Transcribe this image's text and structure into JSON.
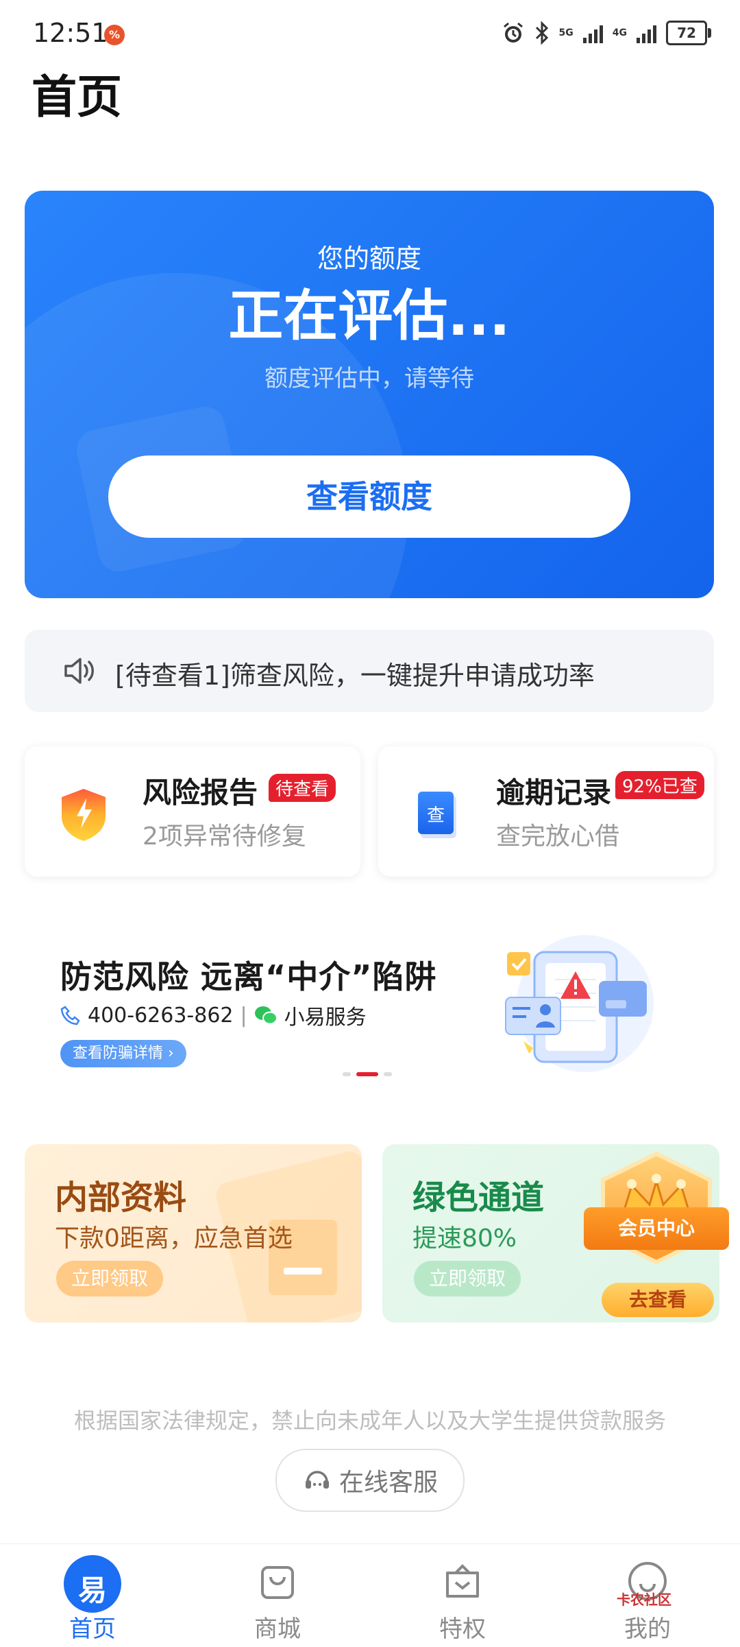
{
  "status_bar": {
    "time": "12:51",
    "notif_badge": "%",
    "signal_1": "5G",
    "signal_2": "4G",
    "battery": "72"
  },
  "page": {
    "title": "首页"
  },
  "hero": {
    "subtitle": "您的额度",
    "title": "正在评估...",
    "note": "额度评估中，请等待",
    "button": "查看额度",
    "color_start": "#2a84fb",
    "color_end": "#1463ec"
  },
  "notice": {
    "text": "[待查看1]筛查风险，一键提升申请成功率"
  },
  "cards": [
    {
      "title": "风险报告",
      "badge": "待查看",
      "desc": "2项异常待修复",
      "icon": "shield-lightning-icon"
    },
    {
      "title": "逾期记录",
      "badge": "92%已查",
      "desc": "查完放心借",
      "icon": "document-check-icon",
      "icon_text": "查"
    }
  ],
  "banner": {
    "title": "防范风险  远离“中介”陷阱",
    "phone": "400-6263-862",
    "separator": "|",
    "service": "小易服务",
    "link": "查看防骗详情 ›",
    "illustration": "phone-warning-illustration"
  },
  "promos": [
    {
      "title": "内部资料",
      "subtitle": "下款0距离，应急首选",
      "button": "立即领取"
    },
    {
      "title": "绿色通道",
      "subtitle": "提速80%",
      "button": "立即领取",
      "member_label": "会员中心",
      "member_button": "去查看"
    }
  ],
  "footer": {
    "legal": "根据国家法律规定，禁止向未成年人以及大学生提供贷款服务",
    "customer_service": "在线客服"
  },
  "tabs": [
    {
      "label": "首页",
      "icon": "home-logo-icon",
      "active": true,
      "icon_text": "易"
    },
    {
      "label": "商城",
      "icon": "shopping-bag-icon",
      "active": false
    },
    {
      "label": "特权",
      "icon": "privilege-bag-icon",
      "active": false
    },
    {
      "label": "我的",
      "icon": "profile-smile-icon",
      "active": false
    }
  ],
  "watermark": "卡农社区",
  "accent_color": "#1c6ef2",
  "badge_color": "#e5202e"
}
